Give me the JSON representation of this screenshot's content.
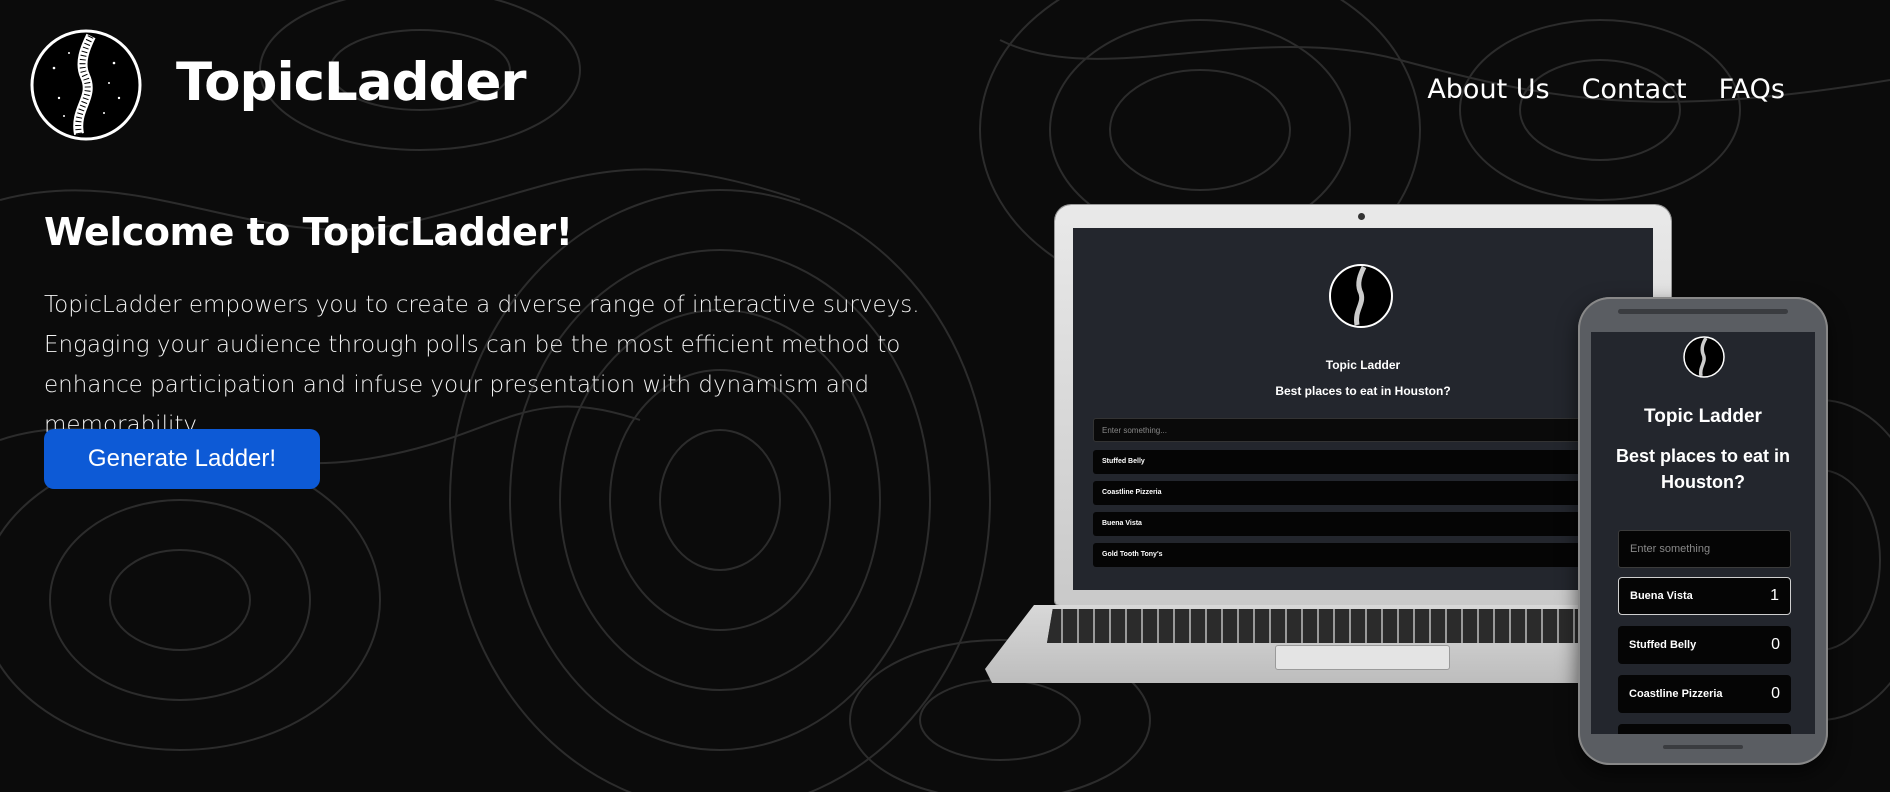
{
  "brand": "TopicLadder",
  "nav": [
    "About Us",
    "Contact",
    "FAQs"
  ],
  "hero": {
    "title": "Welcome to TopicLadder!",
    "text": "TopicLadder empowers you to create a diverse range of interactive surveys. Engaging your audience through polls can be the most efficient method to enhance participation and infuse your presentation with dynamism and memorability.",
    "cta": "Generate Ladder!"
  },
  "laptop": {
    "brand": "Topic Ladder",
    "question": "Best places to eat in Houston?",
    "placeholder": "Enter something...",
    "items": [
      "Stuffed Belly",
      "Coastline Pizzeria",
      "Buena Vista",
      "Gold Tooth Tony's"
    ]
  },
  "phone": {
    "brand": "Topic Ladder",
    "question": "Best places to eat in Houston?",
    "placeholder": "Enter something",
    "items": [
      {
        "name": "Buena Vista",
        "count": "1"
      },
      {
        "name": "Stuffed Belly",
        "count": "0"
      },
      {
        "name": "Coastline Pizzeria",
        "count": "0"
      }
    ]
  },
  "colors": {
    "background": "#0b0b0b",
    "accent": "#0d5ad6",
    "screen": "#23262d"
  }
}
